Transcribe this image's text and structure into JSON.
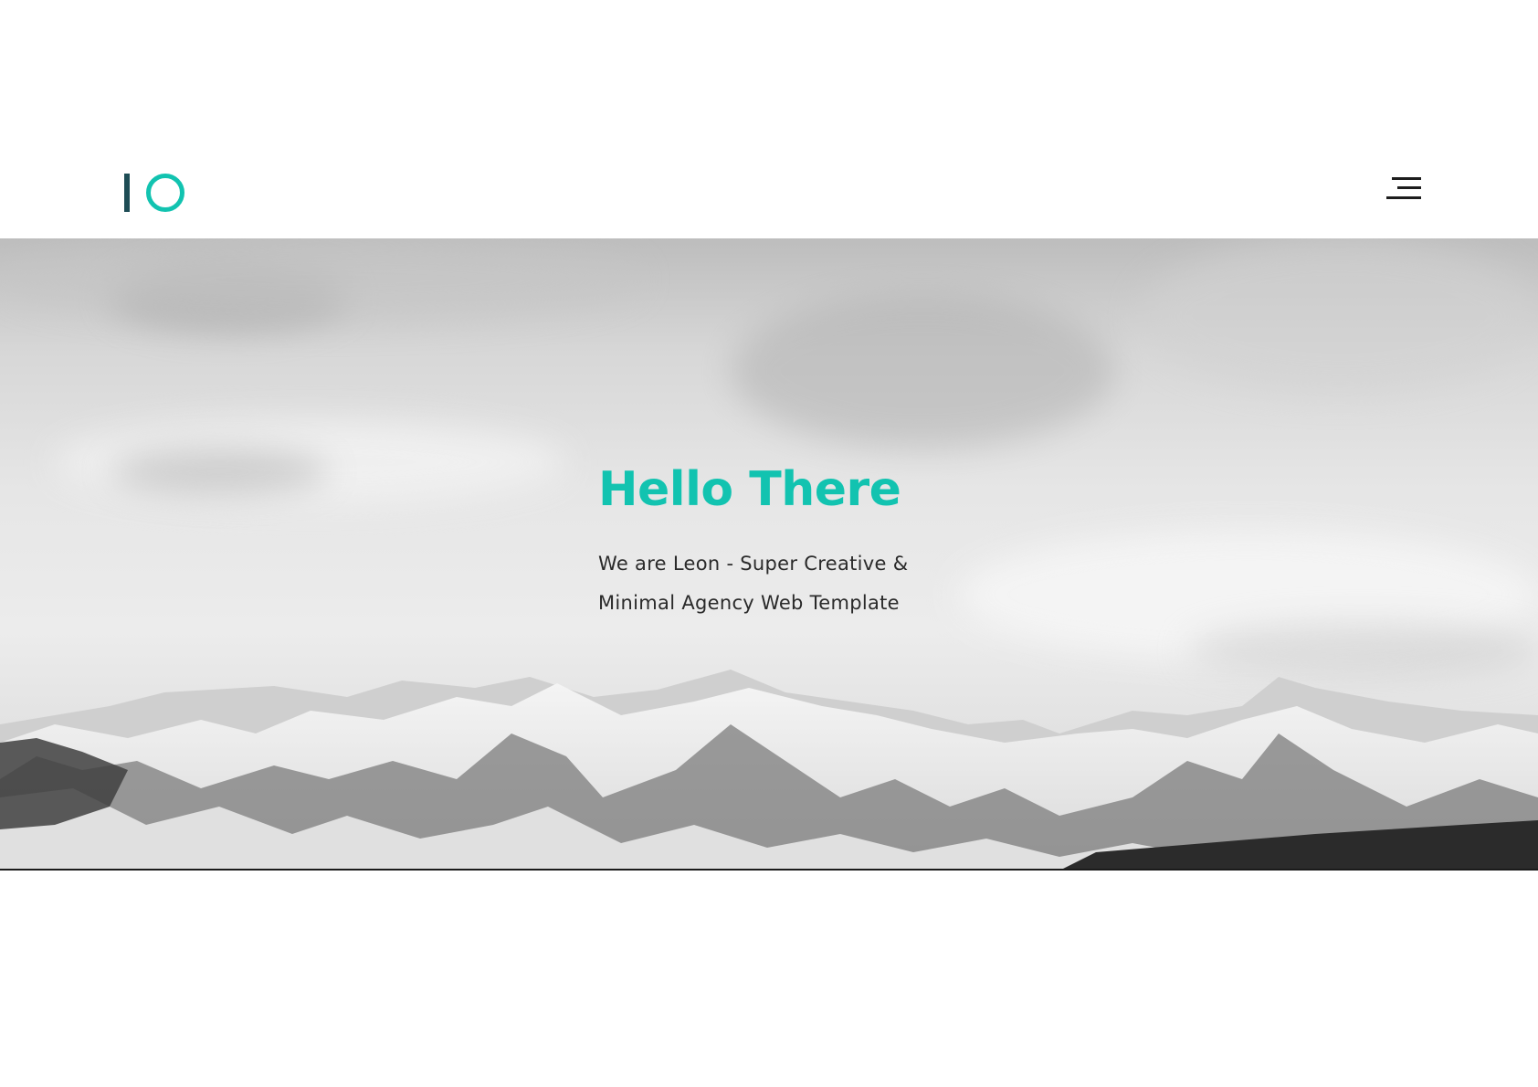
{
  "header": {
    "logo_icon": "io-logo-icon",
    "menu_icon": "hamburger-menu-icon"
  },
  "hero": {
    "title": "Hello There",
    "subtitle_line1": "We are Leon - Super Creative &",
    "subtitle_line2": "Minimal Agency Web Template",
    "background": "snowy-mountains-image"
  },
  "colors": {
    "accent": "#12c3b0",
    "logo_bar": "#1e4d55",
    "text": "#2a2a2a",
    "menu": "#1d1d1d"
  }
}
